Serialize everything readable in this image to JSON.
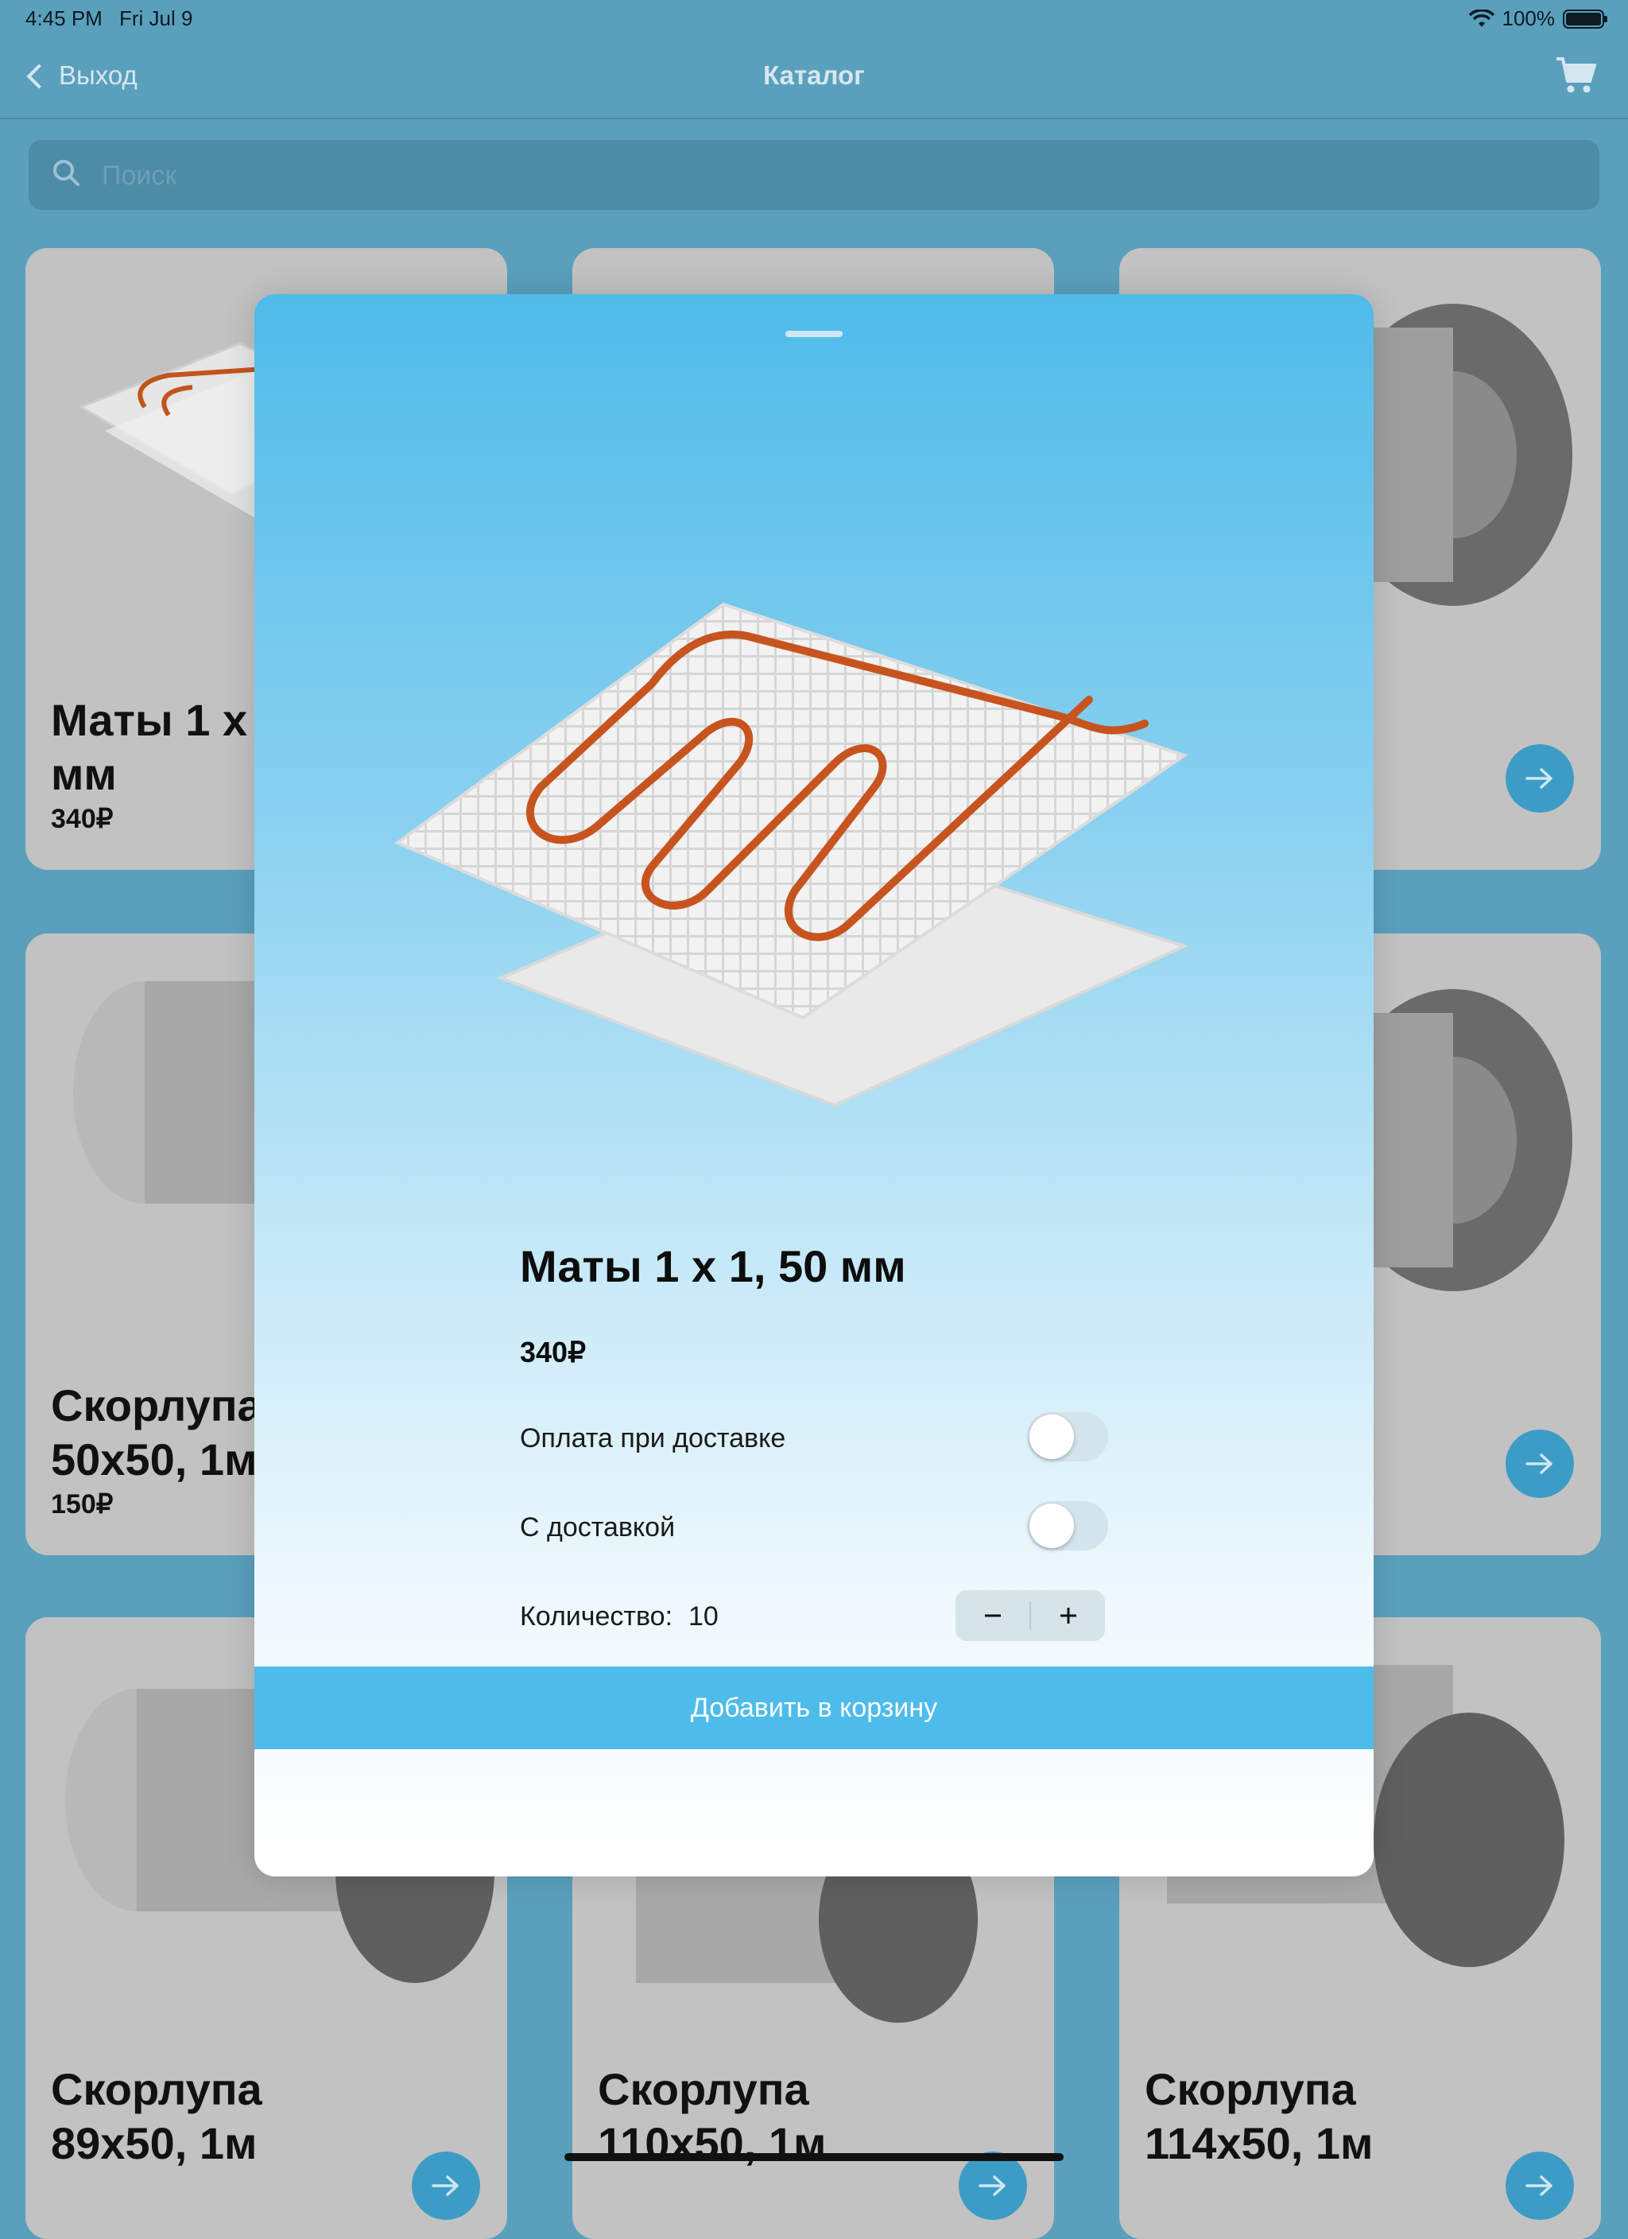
{
  "status_bar": {
    "time": "4:45 PM",
    "date": "Fri Jul 9",
    "battery": "100%"
  },
  "nav": {
    "back_label": "Выход",
    "title": "Каталог"
  },
  "search": {
    "placeholder": "Поиск"
  },
  "catalog": {
    "cards": [
      {
        "title": "Маты 1 х",
        "title2": "мм",
        "price": "340₽"
      },
      {
        "title": "Скорлупа",
        "title2": "50x50, 1м",
        "price": "150₽"
      },
      {
        "title": "Скорлупа",
        "title2": "89x50, 1м"
      },
      {
        "title": "Скорлупа",
        "title2": "110x50, 1м"
      },
      {
        "title": "Скорлупа",
        "title2": "114x50, 1м"
      }
    ]
  },
  "product_sheet": {
    "title": "Маты 1 х 1, 50 мм",
    "price": "340₽",
    "options": [
      {
        "label": "Оплата при доставке",
        "enabled": false
      },
      {
        "label": "С доставкой",
        "enabled": false
      }
    ],
    "quantity_label": "Количество:",
    "quantity_value": "10",
    "add_to_cart_label": "Добавить в корзину"
  },
  "colors": {
    "accent": "#4dbceb",
    "arrow_button": "#3d9cc6",
    "background": "#5aa0bd"
  }
}
